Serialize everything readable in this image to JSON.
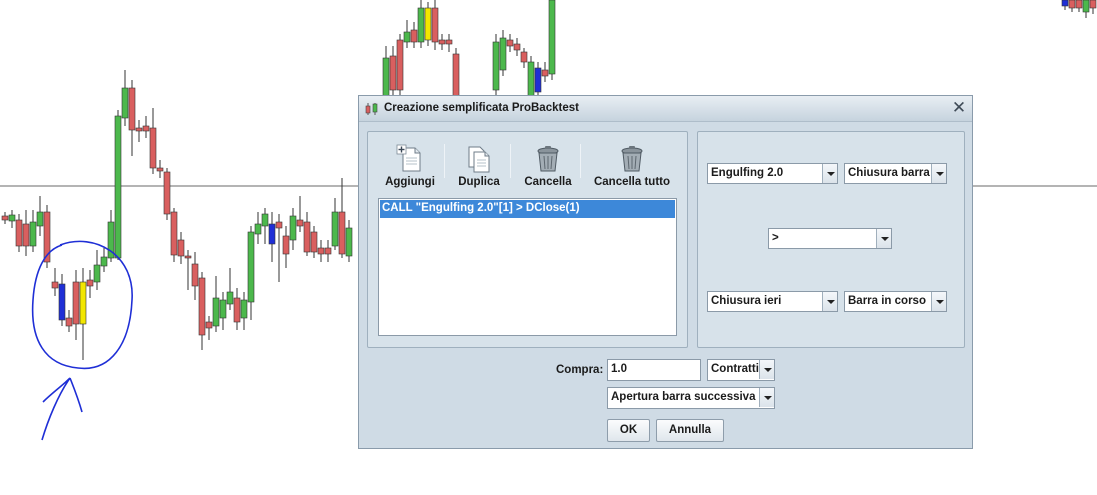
{
  "dialog": {
    "title": "Creazione semplificata ProBacktest",
    "close_glyph": "✕"
  },
  "toolbar": {
    "add_label": "Aggiungi",
    "duplicate_label": "Duplica",
    "delete_label": "Cancella",
    "delete_all_label": "Cancella tutto"
  },
  "conditions": {
    "items": [
      "CALL \"Engulfing 2.0\"[1] > DClose(1)"
    ]
  },
  "condition_editor": {
    "left_indicator": "Engulfing 2.0",
    "left_field": "Chiusura barra",
    "operator": ">",
    "right_indicator": "Chiusura ieri",
    "right_field": "Barra in corso"
  },
  "order": {
    "buy_label": "Compra:",
    "quantity": "1.0",
    "unit": "Contratti",
    "execution": "Apertura barra successiva"
  },
  "buttons": {
    "ok": "OK",
    "cancel": "Annulla"
  },
  "colors": {
    "bull": "#4cb84c",
    "bear": "#d95f5f",
    "blue_candle": "#1f2fd6",
    "yellow_candle": "#f2e600",
    "annotation": "#1f2fd6"
  },
  "icons": {
    "app": "probacktest-icon",
    "add": "add-document-icon",
    "duplicate": "duplicate-documents-icon",
    "delete": "trash-icon",
    "delete_all": "trash-all-icon"
  }
}
